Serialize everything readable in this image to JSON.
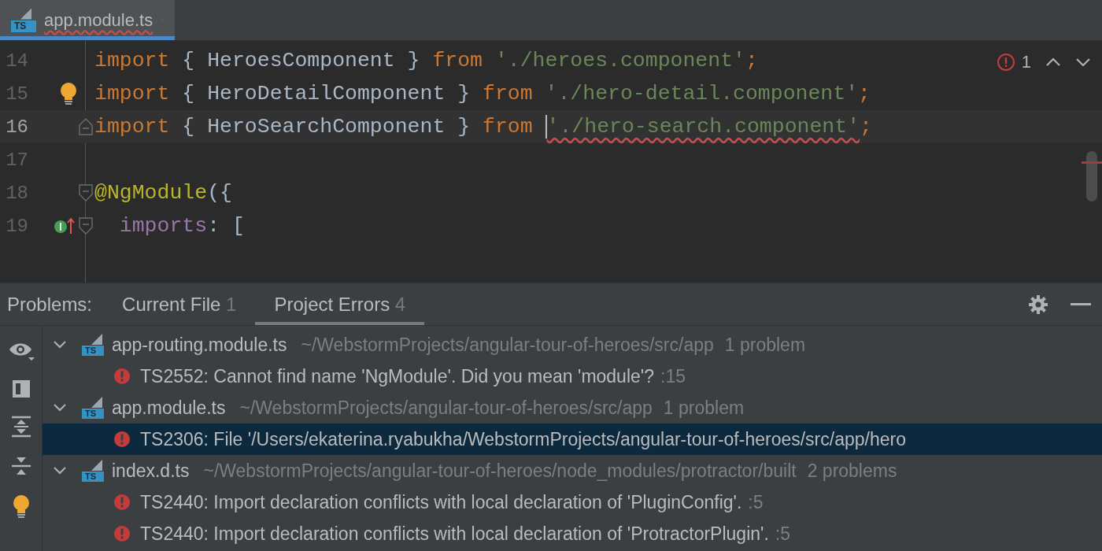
{
  "editor_tab": {
    "filename": "app.module.ts",
    "badge": "TS",
    "selected": true,
    "has_error": true
  },
  "editor": {
    "error_count": "1",
    "lines": [
      {
        "number": "14",
        "current": false,
        "bulb": false,
        "implemented": false,
        "fold_start": false,
        "fold_end": false,
        "tokens": [
          {
            "kind": "keyword",
            "text": "import"
          },
          {
            "kind": "plain",
            "text": " { HeroesComponent } "
          },
          {
            "kind": "keyword",
            "text": "from "
          },
          {
            "kind": "string",
            "text": "'./heroes.component'",
            "error": false
          },
          {
            "kind": "keyword",
            "text": ";"
          }
        ]
      },
      {
        "number": "15",
        "current": false,
        "bulb": true,
        "implemented": false,
        "fold_start": false,
        "fold_end": false,
        "tokens": [
          {
            "kind": "keyword",
            "text": "import"
          },
          {
            "kind": "plain",
            "text": " { HeroDetailComponent } "
          },
          {
            "kind": "keyword",
            "text": "from "
          },
          {
            "kind": "string",
            "text": "'./hero-detail.component'",
            "error": false
          },
          {
            "kind": "keyword",
            "text": ";"
          }
        ]
      },
      {
        "number": "16",
        "current": true,
        "bulb": false,
        "implemented": false,
        "fold_start": false,
        "fold_end": true,
        "tokens": [
          {
            "kind": "keyword",
            "text": "import"
          },
          {
            "kind": "plain",
            "text": " { HeroSearchComponent } "
          },
          {
            "kind": "keyword",
            "text": "from "
          },
          {
            "kind": "string",
            "text": "'./hero-search.component'",
            "error": true,
            "caret": true
          },
          {
            "kind": "keyword",
            "text": ";"
          }
        ]
      },
      {
        "number": "17",
        "current": false,
        "bulb": false,
        "implemented": false,
        "fold_start": false,
        "fold_end": false
      },
      {
        "number": "18",
        "current": false,
        "bulb": false,
        "implemented": false,
        "fold_start": true,
        "fold_end": false,
        "tokens": [
          {
            "kind": "annotation",
            "text": "@NgModule"
          },
          {
            "kind": "plain",
            "text": "({"
          }
        ]
      },
      {
        "number": "19",
        "current": false,
        "bulb": false,
        "implemented": true,
        "fold_start": true,
        "fold_end": false,
        "tokens": [
          {
            "kind": "property",
            "text": "  imports"
          },
          {
            "kind": "plain",
            "text": ": ["
          }
        ]
      }
    ]
  },
  "problems": {
    "label": "Problems:",
    "tabs": [
      {
        "label": "Current File",
        "count": "1",
        "selected": false
      },
      {
        "label": "Project Errors",
        "count": "4",
        "selected": true
      }
    ],
    "groups": [
      {
        "file": "app-routing.module.ts",
        "badge": "TS",
        "path": "~/WebstormProjects/angular-tour-of-heroes/src/app",
        "summary": "1 problem",
        "expanded": true,
        "problems": [
          {
            "message": "TS2552: Cannot find name 'NgModule'. Did you mean 'module'?",
            "location": ":15",
            "selected": false
          }
        ]
      },
      {
        "file": "app.module.ts",
        "badge": "TS",
        "path": "~/WebstormProjects/angular-tour-of-heroes/src/app",
        "summary": "1 problem",
        "expanded": true,
        "problems": [
          {
            "message": "TS2306: File '/Users/ekaterina.ryabukha/WebstormProjects/angular-tour-of-heroes/src/app/hero",
            "selected": true
          }
        ]
      },
      {
        "file": "index.d.ts",
        "badge": "TS",
        "path": "~/WebstormProjects/angular-tour-of-heroes/node_modules/protractor/built",
        "summary": "2 problems",
        "expanded": true,
        "problems": [
          {
            "message": "TS2440: Import declaration conflicts with local declaration of 'PluginConfig'.",
            "location": ":5",
            "selected": false
          },
          {
            "message": "TS2440: Import declaration conflicts with local declaration of 'ProtractorPlugin'.",
            "location": ":5",
            "selected": false
          }
        ]
      }
    ]
  }
}
